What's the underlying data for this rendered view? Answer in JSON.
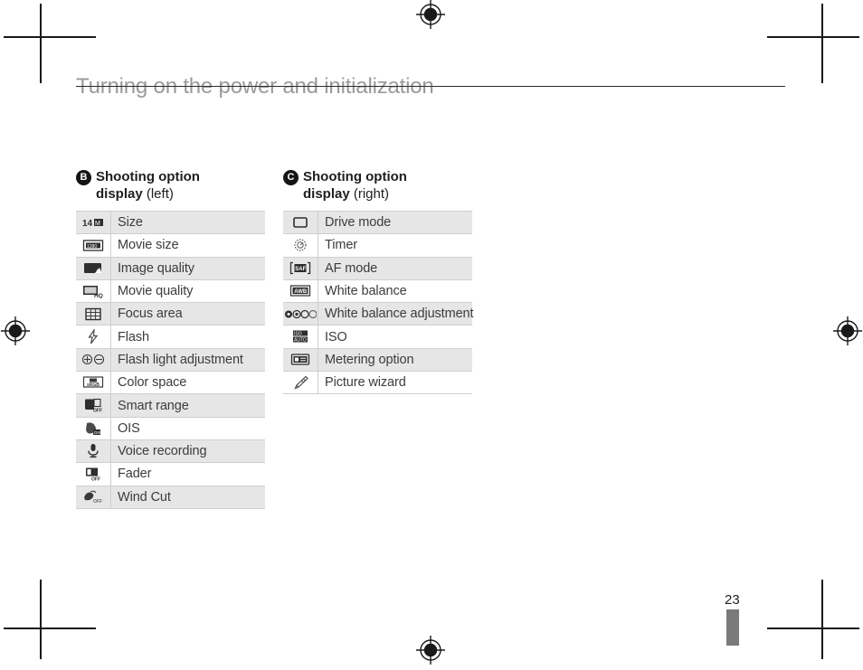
{
  "document": {
    "page_title": "Turning on the power and initialization",
    "page_number": "23"
  },
  "sections": [
    {
      "badge": "B",
      "title_line1": "Shooting option",
      "title_line2": "display",
      "title_paren": "(right)",
      "title_paren_left": "(left)",
      "rows": [
        {
          "icon": "resolution-14m-icon",
          "label": "Size"
        },
        {
          "icon": "movie-size-icon",
          "label": "Movie size"
        },
        {
          "icon": "image-quality-icon",
          "label": "Image quality"
        },
        {
          "icon": "movie-quality-hq-icon",
          "label": "Movie quality"
        },
        {
          "icon": "focus-area-grid-icon",
          "label": "Focus area"
        },
        {
          "icon": "flash-icon",
          "label": "Flash"
        },
        {
          "icon": "flash-light-adjustment-icon",
          "label": "Flash light adjustment"
        },
        {
          "icon": "color-space-srgb-icon",
          "label": "Color space"
        },
        {
          "icon": "smart-range-off-icon",
          "label": "Smart range"
        },
        {
          "icon": "ois-icon",
          "label": "OIS"
        },
        {
          "icon": "voice-recording-mic-icon",
          "label": "Voice recording"
        },
        {
          "icon": "fader-off-icon",
          "label": "Fader"
        },
        {
          "icon": "wind-cut-off-icon",
          "label": "Wind Cut"
        }
      ]
    },
    {
      "badge": "C",
      "title_line1": "Shooting option",
      "title_line2": "display",
      "title_paren": "(right)",
      "rows": [
        {
          "icon": "drive-mode-single-icon",
          "label": "Drive mode"
        },
        {
          "icon": "timer-icon",
          "label": "Timer"
        },
        {
          "icon": "af-mode-saf-icon",
          "label": "AF mode"
        },
        {
          "icon": "white-balance-awb-icon",
          "label": "White balance"
        },
        {
          "icon": "white-balance-adjustment-icon",
          "label": "White balance adjustment"
        },
        {
          "icon": "iso-auto-icon",
          "label": "ISO"
        },
        {
          "icon": "metering-option-icon",
          "label": "Metering option"
        },
        {
          "icon": "picture-wizard-icon",
          "label": "Picture wizard"
        }
      ]
    }
  ],
  "colors": {
    "title_gray": "#9a9a9a",
    "row_shade": "#e6e6e6",
    "text": "#3c3c3c",
    "badge": "#151515",
    "tab": "#7a7a7a"
  }
}
